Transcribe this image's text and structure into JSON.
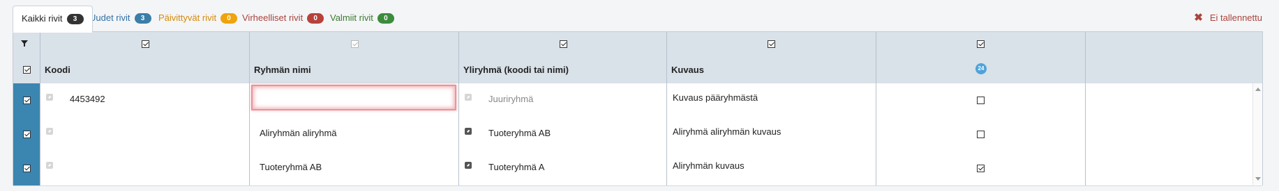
{
  "tabs": [
    {
      "label": "Kaikki rivit",
      "count": "3",
      "color": "#333333",
      "text_color": "#222222"
    },
    {
      "label": "Uudet rivit",
      "count": "3",
      "color": "#3b7ea8",
      "text_color": "#3070a6"
    },
    {
      "label": "Päivittyvät rivit",
      "count": "0",
      "color": "#f0a30a",
      "text_color": "#d58a0c"
    },
    {
      "label": "Virheelliset rivit",
      "count": "0",
      "color": "#b7423b",
      "text_color": "#a9443c"
    },
    {
      "label": "Valmiit rivit",
      "count": "0",
      "color": "#3c8c3c",
      "text_color": "#3a7a2e"
    }
  ],
  "status": {
    "unsaved_label": "Ei tallennettu",
    "unsaved_color": "#a9443c"
  },
  "grid": {
    "columns": [
      {
        "title": "Koodi"
      },
      {
        "title": "Ryhmän nimi"
      },
      {
        "title": "Yliryhmä (koodi tai nimi)"
      },
      {
        "title": "Kuvaus"
      },
      {
        "title": "",
        "badge": "24"
      }
    ],
    "rows": [
      {
        "koodi": "4453492",
        "ryhman_nimi": "",
        "ylirhyma": "Juuriryhmä",
        "kuvaus": "Kuvaus pääryhmästä",
        "checked": false
      },
      {
        "koodi": "",
        "ryhman_nimi": "Aliryhmän aliryhmä",
        "ylirhyma": "Tuoteryhmä AB",
        "kuvaus": "Aliryhmä aliryhmän kuvaus",
        "checked": false
      },
      {
        "koodi": "",
        "ryhman_nimi": "Tuoteryhmä AB",
        "ylirhyma": "Tuoteryhmä A",
        "kuvaus": "Aliryhmän kuvaus",
        "checked": true
      }
    ]
  },
  "colors": {
    "row_select_bg": "#3a86b1",
    "header_bg": "#d9e1e9",
    "error_border": "#e7959a"
  }
}
